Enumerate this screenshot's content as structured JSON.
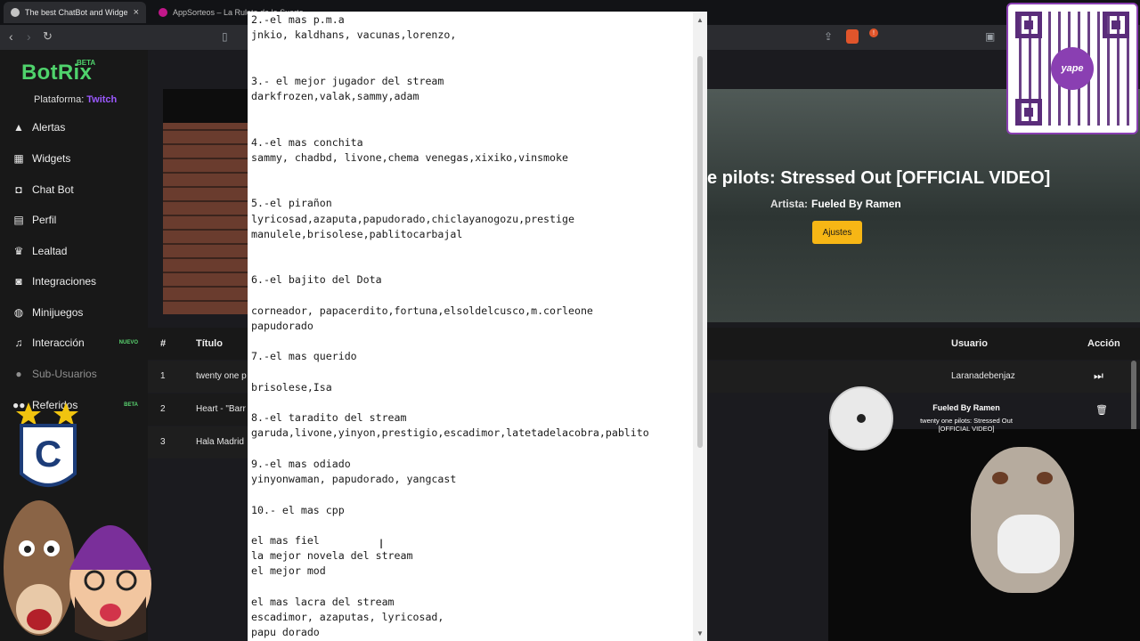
{
  "browser": {
    "tabs": [
      {
        "title": "The best ChatBot and Widge",
        "close": "×"
      },
      {
        "title": "AppSorteos – La Ruleta de la Suerte"
      }
    ]
  },
  "sidebar": {
    "logo": "BotRix",
    "logo_badge": "BETA",
    "platform_label": "Plataforma:",
    "platform_value": "Twitch",
    "items": [
      {
        "label": "Alertas",
        "icon": "warning-icon"
      },
      {
        "label": "Widgets",
        "icon": "grid-icon"
      },
      {
        "label": "Chat Bot",
        "icon": "robot-icon"
      },
      {
        "label": "Perfil",
        "icon": "id-card-icon"
      },
      {
        "label": "Lealtad",
        "icon": "trophy-icon"
      },
      {
        "label": "Integraciones",
        "icon": "plug-icon"
      },
      {
        "label": "Minijuegos",
        "icon": "gamepad-icon"
      },
      {
        "label": "Interacción",
        "icon": "music-icon",
        "tag": "NUEVO"
      },
      {
        "label": "Sub-Usuarios",
        "icon": "user-icon"
      },
      {
        "label": "Referidos",
        "icon": "users-icon",
        "tag": "BETA"
      }
    ]
  },
  "playlist": {
    "headers": [
      "#",
      "Título"
    ],
    "rows": [
      {
        "num": "1",
        "title": "twenty one p"
      },
      {
        "num": "2",
        "title": "Heart - \"Barr"
      },
      {
        "num": "3",
        "title": "Hala Madrid"
      }
    ]
  },
  "notepad": {
    "text": "2.-el mas p.m.a\njnkio, kaldhans, vacunas,lorenzo,\n\n\n3.- el mejor jugador del stream\ndarkfrozen,valak,sammy,adam\n\n\n4.-el mas conchita\nsammy, chadbd, livone,chema venegas,xixiko,vinsmoke\n\n\n5.-el pirañon\nlyricosad,azaputa,papudorado,chiclayanogozu,prestige\nmanulele,brisolese,pablitocarbajal\n\n\n6.-el bajito del Dota\n\ncorneador, papacerdito,fortuna,elsoldelcusco,m.corleone\npapudorado\n\n7.-el mas querido\n\nbrisolese,Isa\n\n8.-el taradito del stream\ngaruda,livone,yinyon,prestigio,escadimor,latetadelacobra,pablito\n\n9.-el mas odiado\nyinyonwaman, papudorado, yangcast\n\n10.- el mas cpp\n\nel mas fiel\nla mejor novela del stream\nel mejor mod\n\nel mas lacra del stream\nescadimor, azaputas, lyricosad,\npapu dorado"
  },
  "now_playing": {
    "song_title": "e pilots: Stressed Out [OFFICIAL VIDEO]",
    "artist_label": "Artista:",
    "artist": "Fueled By Ramen",
    "settings_button": "Ajustes",
    "card_artist": "Fueled By Ramen",
    "card_title": "twenty one pilots: Stressed Out [OFFICIAL VIDEO]"
  },
  "queue": {
    "headers": [
      "Usuario",
      "Acción"
    ],
    "user": "Laranadebenjaz"
  },
  "qr": {
    "brand": "yape"
  },
  "colors": {
    "brand_green": "#4fd36c",
    "twitch_purple": "#9b59ff",
    "button_yellow": "#f7b615",
    "yape_purple": "#8a3fb2"
  }
}
